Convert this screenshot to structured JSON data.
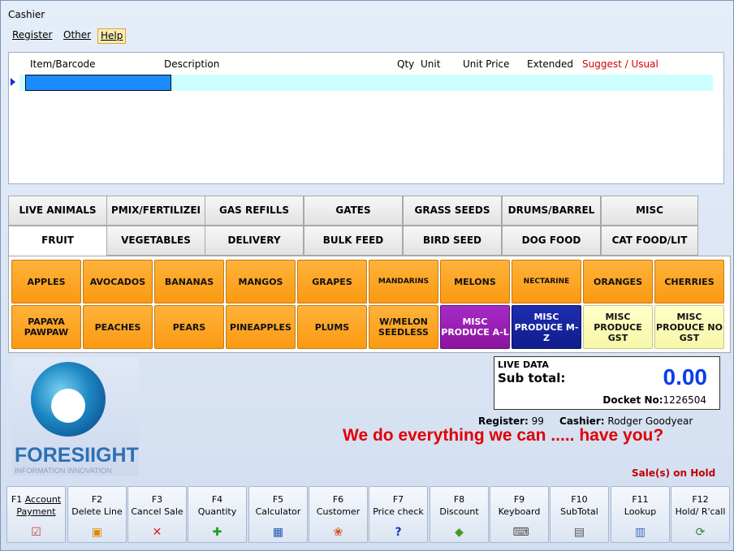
{
  "window": {
    "title": "Cashier"
  },
  "menu": [
    {
      "label": "Register",
      "active": false
    },
    {
      "label": "Other",
      "active": false
    },
    {
      "label": "Help",
      "active": true
    }
  ],
  "grid": {
    "columns": [
      "Item/Barcode",
      "Description",
      "Qty",
      "Unit",
      "Unit Price",
      "Extended",
      "Suggest / Usual"
    ],
    "row_color": "#ccfefe",
    "input_color": "#1a8cff"
  },
  "category_tabs_row1": [
    "LIVE ANIMALS",
    "PMIX/FERTILIZEI",
    "GAS REFILLS",
    "GATES",
    "GRASS SEEDS",
    "DRUMS/BARREL",
    "MISC"
  ],
  "category_tabs_row2": [
    "FRUIT",
    "VEGETABLES",
    "DELIVERY",
    "BULK FEED",
    "BIRD SEED",
    "DOG FOOD",
    "CAT FOOD/LIT"
  ],
  "selected_tab": "FRUIT",
  "products_row1": [
    "APPLES",
    "AVOCADOS",
    "BANANAS",
    "MANGOS",
    "GRAPES",
    "MANDARINS",
    "MELONS",
    "NECTARINE",
    "ORANGES",
    "CHERRIES"
  ],
  "products_row2": [
    "PAPAYA PAWPAW",
    "PEACHES",
    "PEARS",
    "PINEAPPLES",
    "PLUMS",
    "W/MELON SEEDLESS",
    "MISC PRODUCE A-L",
    "MISC PRODUCE M-Z",
    "MISC PRODUCE GST",
    "MISC PRODUCE NO GST"
  ],
  "logo": {
    "word": "FORESIIGHT",
    "tagline": "INFORMATION INNOVATION"
  },
  "live_data": {
    "label": "LIVE DATA",
    "subtotal_label": "Sub total:",
    "subtotal_value": "0.00",
    "docket_label": "Docket No:",
    "docket_value": "1226504"
  },
  "register": {
    "label": "Register:",
    "value": "99"
  },
  "cashier": {
    "label": "Cashier:",
    "value": "Rodger Goodyear"
  },
  "slogan": "We do everything we can ..... have you?",
  "on_hold": "Sale(s) on Hold",
  "fkeys": [
    {
      "key": "F1",
      "label": "Account Payment",
      "icon": "payment-icon",
      "glyph": "☑"
    },
    {
      "key": "F2",
      "label": "Delete Line",
      "icon": "delete-line-icon",
      "glyph": "▣"
    },
    {
      "key": "F3",
      "label": "Cancel Sale",
      "icon": "cancel-icon",
      "glyph": "✕"
    },
    {
      "key": "F4",
      "label": "Quantity",
      "icon": "plus-icon",
      "glyph": "✚"
    },
    {
      "key": "F5",
      "label": "Calculator",
      "icon": "calculator-icon",
      "glyph": "▦"
    },
    {
      "key": "F6",
      "label": "Customer",
      "icon": "customer-icon",
      "glyph": "❀"
    },
    {
      "key": "F7",
      "label": "Price check",
      "icon": "question-icon",
      "glyph": "?"
    },
    {
      "key": "F8",
      "label": "Discount",
      "icon": "discount-icon",
      "glyph": "◆"
    },
    {
      "key": "F9",
      "label": "Keyboard",
      "icon": "keyboard-icon",
      "glyph": "⌨"
    },
    {
      "key": "F10",
      "label": "SubTotal",
      "icon": "subtotal-icon",
      "glyph": "▤"
    },
    {
      "key": "F11",
      "label": "Lookup",
      "icon": "lookup-icon",
      "glyph": "▥"
    },
    {
      "key": "F12",
      "label": "Hold/ R'call",
      "icon": "hold-icon",
      "glyph": "⟳"
    }
  ],
  "colors": {
    "orange": "#fb9a12",
    "purple": "#8c149f",
    "navy": "#101d8c",
    "yellow": "#f7f7a9",
    "slogan": "#e00000",
    "subtotal": "#0b3ee6"
  }
}
